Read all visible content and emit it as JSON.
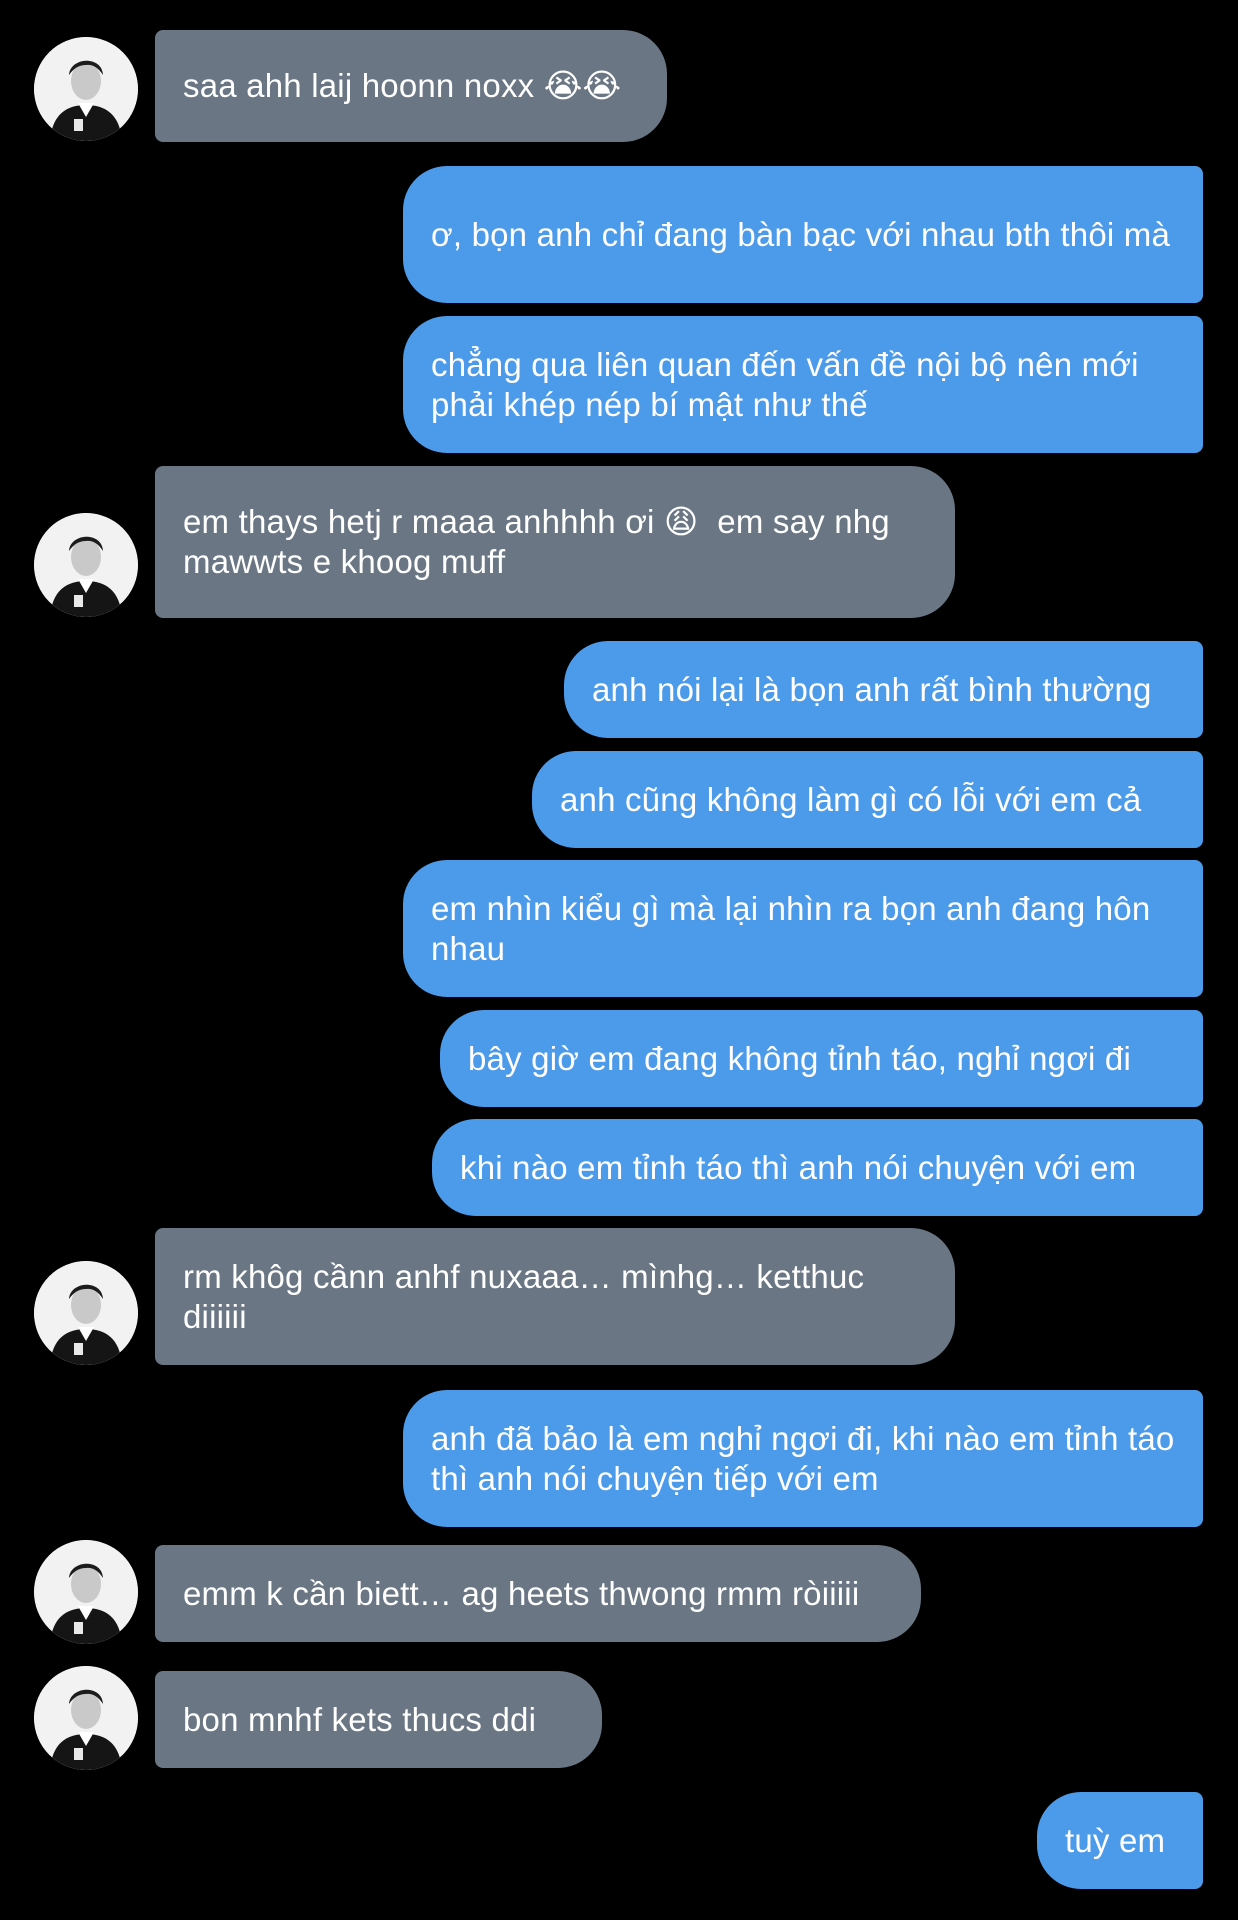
{
  "contact": {
    "avatar": "person-avatar"
  },
  "messages": [
    {
      "side": "in",
      "text": "saa ahh laij hoonn noxx 😭😭",
      "avatar": true
    },
    {
      "side": "out",
      "text": "ơ, bọn anh chỉ đang bàn bạc với nhau bth thôi mà"
    },
    {
      "side": "out",
      "text": "chẳng qua liên quan đến vấn đề nội bộ nên mới phải khép nép bí mật như thế"
    },
    {
      "side": "in",
      "text": "em thays hetj r maaa anhhhh ơi 😩  em say nhg mawwts e khoog muff",
      "avatar": true
    },
    {
      "side": "out",
      "text": "anh nói lại là bọn anh rất bình thường"
    },
    {
      "side": "out",
      "text": "anh cũng không làm gì có lỗi với em cả"
    },
    {
      "side": "out",
      "text": "em nhìn kiểu gì mà lại nhìn ra bọn anh đang hôn nhau"
    },
    {
      "side": "out",
      "text": "bây giờ em đang không tỉnh táo, nghỉ ngơi đi"
    },
    {
      "side": "out",
      "text": "khi nào em tỉnh táo thì anh nói chuyện với em"
    },
    {
      "side": "in",
      "text": "rm khôg cầnn anhf nuxaaa… mìnhg… ketthuc diiiiii",
      "avatar": true
    },
    {
      "side": "out",
      "text": "anh đã bảo là em nghỉ ngơi đi, khi nào em tỉnh táo thì anh nói chuyện tiếp với em"
    },
    {
      "side": "in",
      "text": "emm k cần biett… ag heets thwong rmm ròiiiii",
      "avatar": true
    },
    {
      "side": "in",
      "text": "bon mnhf kets thucs ddi",
      "avatar": true
    },
    {
      "side": "out",
      "text": "tuỳ em"
    }
  ]
}
